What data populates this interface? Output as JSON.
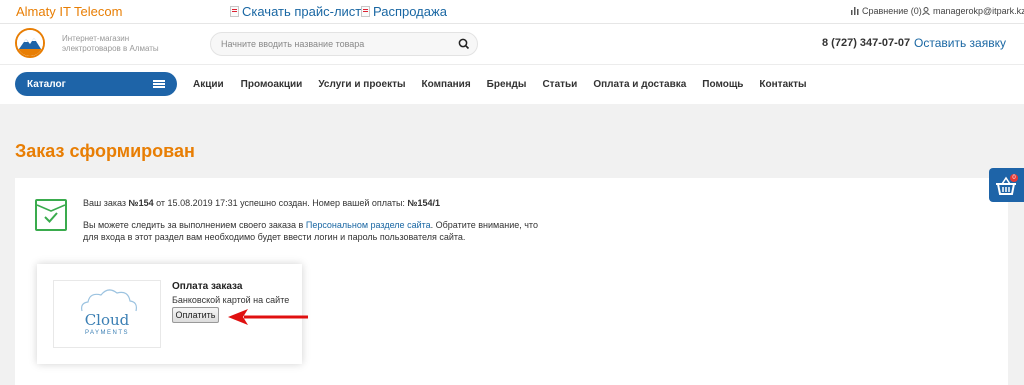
{
  "topbar": {
    "brand": "Almaty IT Telecom",
    "pricelist_link": "Скачать прайс-лист",
    "sale_link": "Распродажа",
    "compare": "Сравнение (0)",
    "user": "managerokp@itpark.kz"
  },
  "header": {
    "tagline_line1": "Интернет-магазин",
    "tagline_line2": "электротоваров в Алматы",
    "search_placeholder": "Начните вводить название товара",
    "phone": "8 (727) 347-07-07",
    "callback": "Оставить заявку"
  },
  "nav": {
    "catalog": "Каталог",
    "items": [
      "Акции",
      "Промоакции",
      "Услуги и проекты",
      "Компания",
      "Бренды",
      "Статьи",
      "Оплата и доставка",
      "Помощь",
      "Контакты"
    ]
  },
  "page": {
    "title": "Заказ сформирован"
  },
  "order": {
    "msg_pre": "Ваш заказ",
    "order_no": "№154",
    "msg_mid": "от 15.08.2019 17:31 успешно создан. Номер вашей оплаты:",
    "payment_no": "№154/1",
    "track_pre": "Вы можете следить за выполнением своего заказа в",
    "track_link": "Персональном разделе сайта",
    "track_post": ". Обратите внимание, что для входа в этот раздел вам необходимо будет ввести логин и пароль пользователя сайта."
  },
  "payment": {
    "logo_word": "Cloud",
    "logo_sub": "PAYMENTS",
    "title": "Оплата заказа",
    "method": "Банковской картой на сайте",
    "button": "Оплатить"
  },
  "cart": {
    "count": "0"
  },
  "colors": {
    "accent": "#e87e04",
    "primary_blue": "#1e64a8",
    "link": "#1a67a3",
    "success": "#3aab4d",
    "arrow": "#e01010"
  }
}
